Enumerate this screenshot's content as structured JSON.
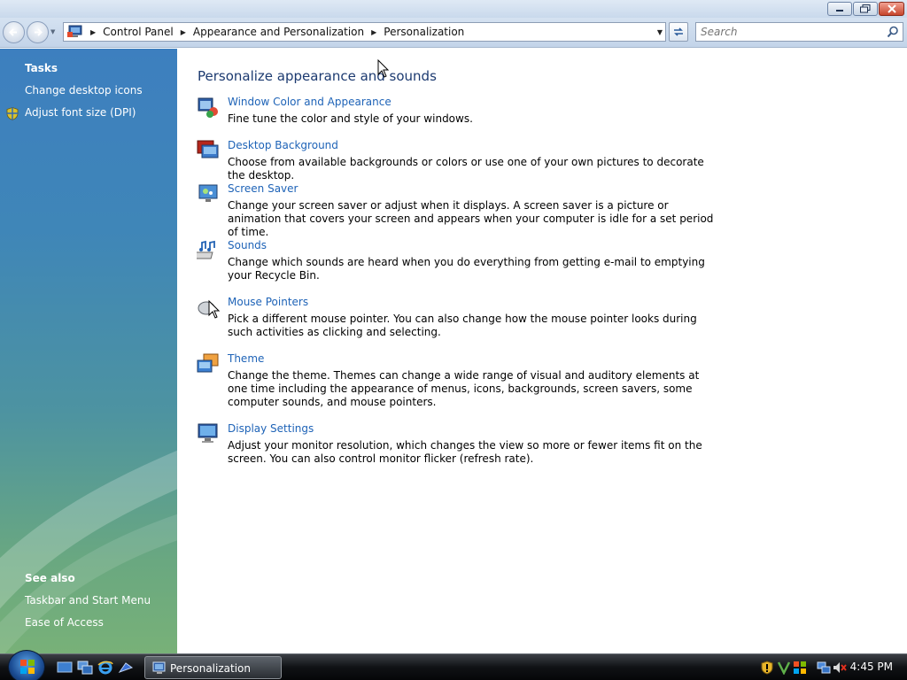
{
  "window": {
    "title_buttons": {
      "minimize_icon": "minimize-icon",
      "maximize_icon": "maximize-icon",
      "close_icon": "close-icon"
    }
  },
  "nav": {
    "breadcrumbs": [
      "Control Panel",
      "Appearance and Personalization",
      "Personalization"
    ],
    "search_placeholder": "Search"
  },
  "sidebar": {
    "tasks_heading": "Tasks",
    "tasks": [
      "Change desktop icons",
      "Adjust font size (DPI)"
    ],
    "see_also_heading": "See also",
    "see_also": [
      "Taskbar and Start Menu",
      "Ease of Access"
    ]
  },
  "main": {
    "title": "Personalize appearance and sounds",
    "items": [
      {
        "label": "Window Color and Appearance",
        "description": "Fine tune the color and style of your windows.",
        "icon": "window-color-icon"
      },
      {
        "label": "Desktop Background",
        "description": "Choose from available backgrounds or colors or use one of your own pictures to decorate the desktop.",
        "icon": "desktop-background-icon"
      },
      {
        "label": "Screen Saver",
        "description": "Change your screen saver or adjust when it displays. A screen saver is a picture or animation that covers your screen and appears when your computer is idle for a set period of time.",
        "icon": "screen-saver-icon"
      },
      {
        "label": "Sounds",
        "description": "Change which sounds are heard when you do everything from getting e-mail to emptying your Recycle Bin.",
        "icon": "sounds-icon"
      },
      {
        "label": "Mouse Pointers",
        "description": "Pick a different mouse pointer. You can also change how the mouse pointer looks during such activities as clicking and selecting.",
        "icon": "mouse-pointers-icon"
      },
      {
        "label": "Theme",
        "description": "Change the theme. Themes can change a wide range of visual and auditory elements at one time including the appearance of menus, icons, backgrounds, screen savers, some computer sounds, and mouse pointers.",
        "icon": "theme-icon"
      },
      {
        "label": "Display Settings",
        "description": "Adjust your monitor resolution, which changes the view so more or fewer items fit on the screen. You can also control monitor flicker (refresh rate).",
        "icon": "display-settings-icon"
      }
    ]
  },
  "taskbar": {
    "active_window": "Personalization",
    "clock": "4:45 PM"
  },
  "colors": {
    "link": "#1e63b7",
    "title": "#1c3a70",
    "sidebar_top": "#3d7fbf",
    "sidebar_bottom": "#78b178"
  }
}
